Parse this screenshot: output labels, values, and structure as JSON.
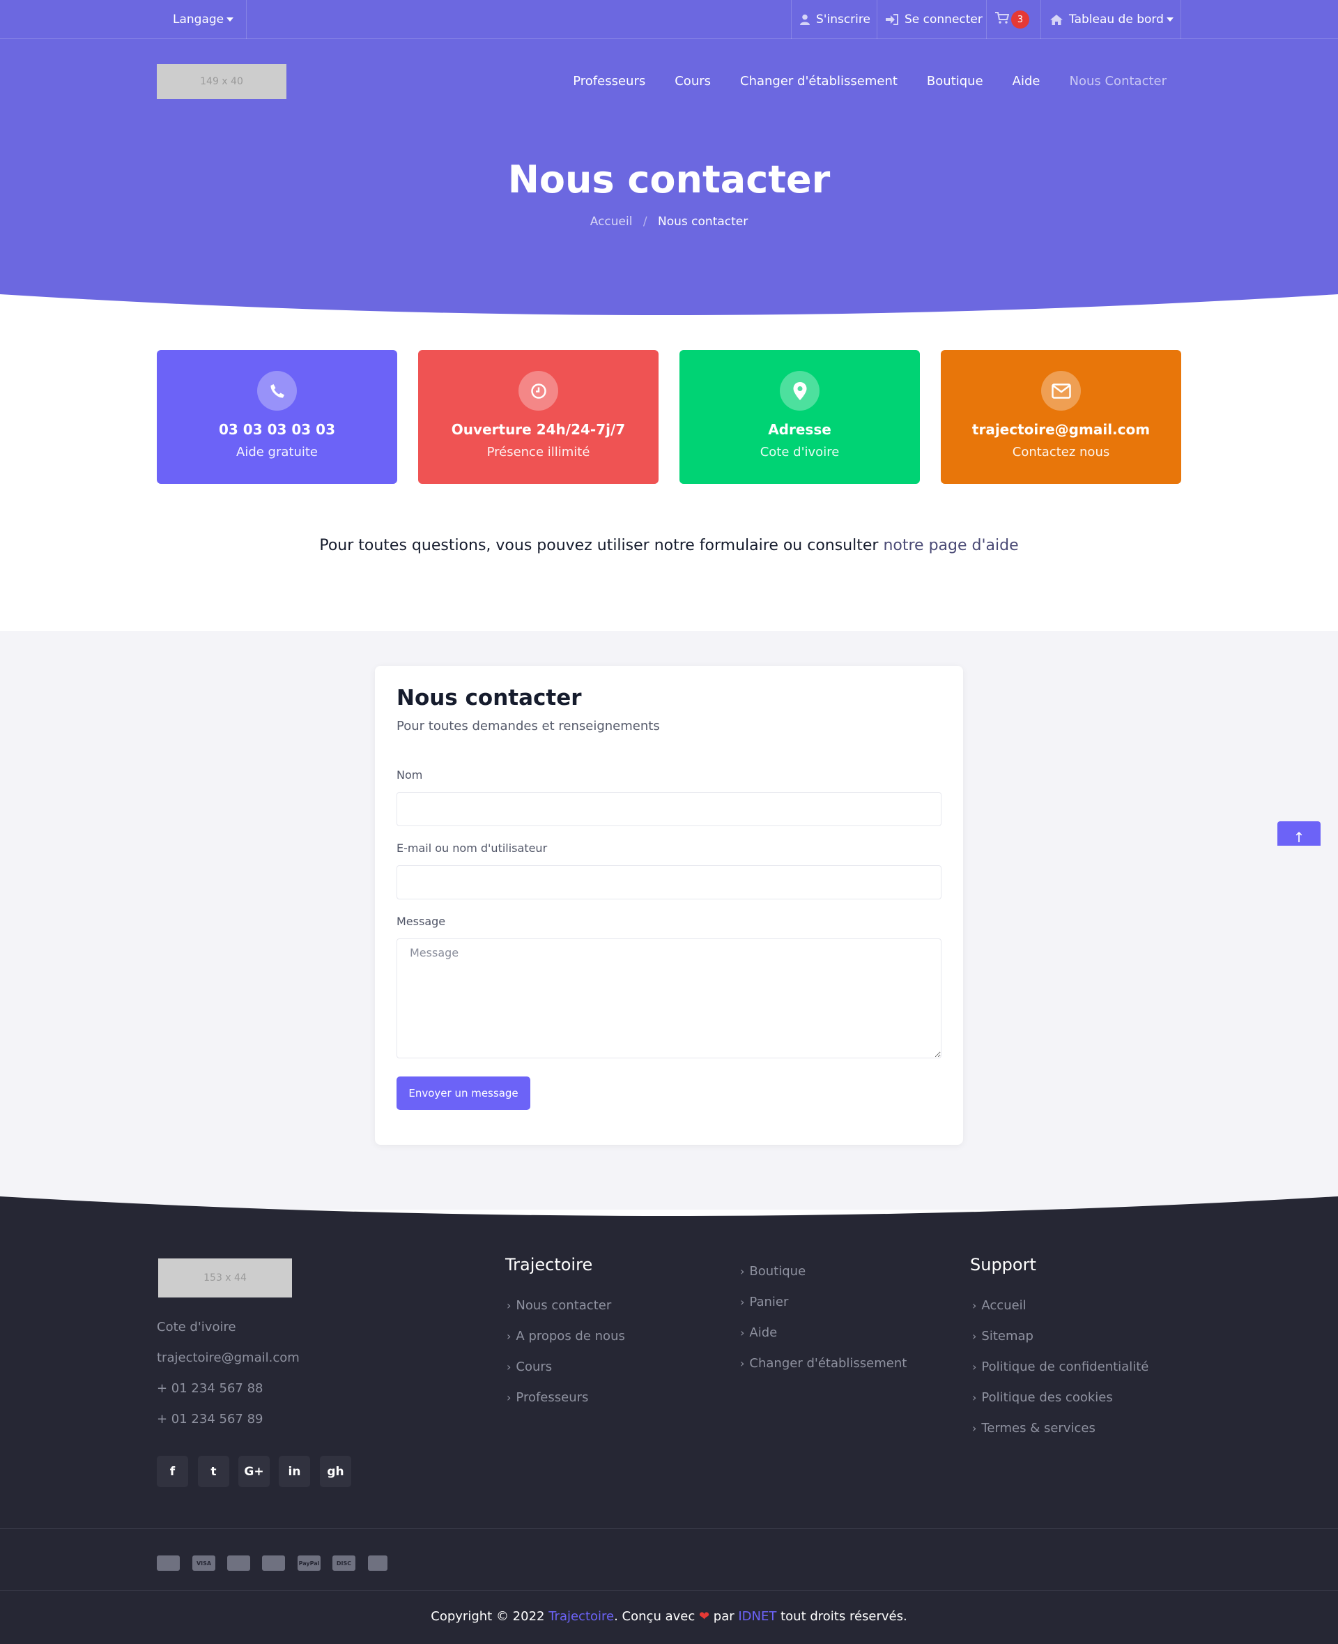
{
  "topbar": {
    "language_label": "Langage",
    "signup_label": "S'inscrire",
    "login_label": "Se connecter",
    "cart_count": "3",
    "dashboard_label": "Tableau de bord"
  },
  "header": {
    "logo_text": "149 x 40",
    "nav": [
      {
        "label": "Professeurs"
      },
      {
        "label": "Cours"
      },
      {
        "label": "Changer d'établissement"
      },
      {
        "label": "Boutique"
      },
      {
        "label": "Aide"
      },
      {
        "label": "Nous Contacter"
      }
    ]
  },
  "hero": {
    "title": "Nous contacter",
    "breadcrumb_home": "Accueil",
    "breadcrumb_sep": "/",
    "breadcrumb_current": "Nous contacter"
  },
  "cards": [
    {
      "title": "03 03 03 03 03",
      "subtitle": "Aide gratuite",
      "icon": "phone-icon",
      "color": "#6c63f7"
    },
    {
      "title": "Ouverture 24h/24-7j/7",
      "subtitle": "Présence illimité",
      "icon": "clock-icon",
      "color": "#ef5353"
    },
    {
      "title": "Adresse",
      "subtitle": "Cote d'ivoire",
      "icon": "map-pin-icon",
      "color": "#00d374"
    },
    {
      "title": "trajectoire@gmail.com",
      "subtitle": "Contactez nous",
      "icon": "envelope-icon",
      "color": "#e8760a"
    }
  ],
  "helpline": {
    "text": "Pour toutes questions, vous pouvez utiliser notre formulaire ou consulter ",
    "link_label": "notre page d'aide"
  },
  "form": {
    "title": "Nous contacter",
    "subtitle": "Pour toutes demandes et renseignements",
    "name_label": "Nom",
    "name_value": "",
    "email_label": "E-mail ou nom d'utilisateur",
    "email_value": "",
    "message_label": "Message",
    "message_placeholder": "Message",
    "submit_label": "Envoyer un message"
  },
  "scroll_top_label": "↑",
  "footer": {
    "logo_text": "153 x 44",
    "address": "Cote d'ivoire",
    "email": "trajectoire@gmail.com",
    "phone1": "+ 01 234 567 88",
    "phone2": "+ 01 234 567 89",
    "social": [
      {
        "icon": "facebook-icon",
        "glyph": "f"
      },
      {
        "icon": "twitter-icon",
        "glyph": "t"
      },
      {
        "icon": "google-plus-icon",
        "glyph": "G+"
      },
      {
        "icon": "linkedin-icon",
        "glyph": "in"
      },
      {
        "icon": "github-icon",
        "glyph": "gh"
      }
    ],
    "col1_heading": "Trajectoire",
    "col1_links": [
      "Nous contacter",
      "A propos de nous",
      "Cours",
      "Professeurs"
    ],
    "col2_links": [
      "Boutique",
      "Panier",
      "Aide",
      "Changer d'établissement"
    ],
    "col3_heading": "Support",
    "col3_links": [
      "Accueil",
      "Sitemap",
      "Politique de confidentialité",
      "Politique des cookies",
      "Termes & services"
    ],
    "payments": [
      {
        "icon": "amex-card-icon",
        "text": ""
      },
      {
        "icon": "visa-card-icon",
        "text": "VISA"
      },
      {
        "icon": "credit-card-icon",
        "text": ""
      },
      {
        "icon": "mastercard-icon",
        "text": ""
      },
      {
        "icon": "paypal-icon",
        "text": "PayPal"
      },
      {
        "icon": "discover-card-icon",
        "text": "DISC"
      },
      {
        "icon": "wallet-icon",
        "text": ""
      }
    ],
    "copyright_prefix": "Copyright © 2022 ",
    "copyright_brand": "Trajectoire",
    "copyright_mid": ". Conçu avec ",
    "copyright_heart": "❤",
    "copyright_by": " par ",
    "copyright_company": "IDNET",
    "copyright_suffix": " tout droits réservés."
  }
}
